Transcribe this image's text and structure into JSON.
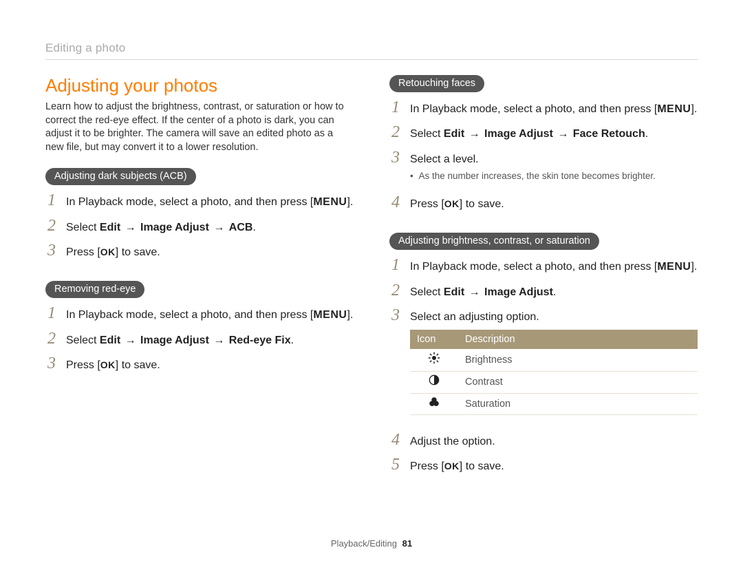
{
  "topTitle": "Editing a photo",
  "heading": "Adjusting your photos",
  "intro": "Learn how to adjust the brightness, contrast, or saturation or how to correct the red-eye effect. If the center of a photo is dark, you can adjust it to be brighter. The camera will save an edited photo as a new file, but may convert it to a lower resolution.",
  "labels": {
    "menu": "MENU",
    "ok": "OK",
    "select": "Select ",
    "arrow": " → ",
    "edit": "Edit",
    "imageAdjust": "Image Adjust",
    "acb": "ACB",
    "redeye": "Red-eye Fix",
    "faceRetouch": "Face Retouch",
    "press": "Press [",
    "pressSuffix": "] to save.",
    "playbackIntro": "In Playback mode, select a photo, and then press [",
    "closeBracketPeriod": "]."
  },
  "sections": {
    "acb": {
      "title": "Adjusting dark subjects (ACB)"
    },
    "redeye": {
      "title": "Removing red-eye"
    },
    "retouch": {
      "title": "Retouching faces",
      "step3": "Select a level.",
      "bullet": "As the number increases, the skin tone becomes brighter."
    },
    "bcs": {
      "title": "Adjusting brightness, contrast, or saturation",
      "step2b": ".",
      "step3": "Select an adjusting option.",
      "step4": "Adjust the option."
    }
  },
  "table": {
    "headIcon": "Icon",
    "headDesc": "Description",
    "rows": [
      {
        "icon": "brightness",
        "desc": "Brightness"
      },
      {
        "icon": "contrast",
        "desc": "Contrast"
      },
      {
        "icon": "saturation",
        "desc": "Saturation"
      }
    ]
  },
  "footer": {
    "section": "Playback/Editing",
    "page": "81"
  }
}
